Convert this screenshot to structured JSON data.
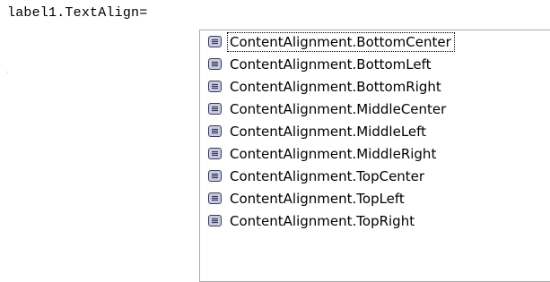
{
  "editor": {
    "code_text": "label1.TextAlign="
  },
  "completion_list": {
    "selected_index": 0,
    "items": [
      {
        "label": "ContentAlignment.BottomCenter",
        "icon": "enum-member-icon"
      },
      {
        "label": "ContentAlignment.BottomLeft",
        "icon": "enum-member-icon"
      },
      {
        "label": "ContentAlignment.BottomRight",
        "icon": "enum-member-icon"
      },
      {
        "label": "ContentAlignment.MiddleCenter",
        "icon": "enum-member-icon"
      },
      {
        "label": "ContentAlignment.MiddleLeft",
        "icon": "enum-member-icon"
      },
      {
        "label": "ContentAlignment.MiddleRight",
        "icon": "enum-member-icon"
      },
      {
        "label": "ContentAlignment.TopCenter",
        "icon": "enum-member-icon"
      },
      {
        "label": "ContentAlignment.TopLeft",
        "icon": "enum-member-icon"
      },
      {
        "label": "ContentAlignment.TopRight",
        "icon": "enum-member-icon"
      }
    ]
  },
  "colors": {
    "icon_border": "#3a3a5a",
    "icon_fill": "#c9cbe0",
    "icon_lines": "#3a3a5a",
    "list_border": "#a9a9a9"
  }
}
